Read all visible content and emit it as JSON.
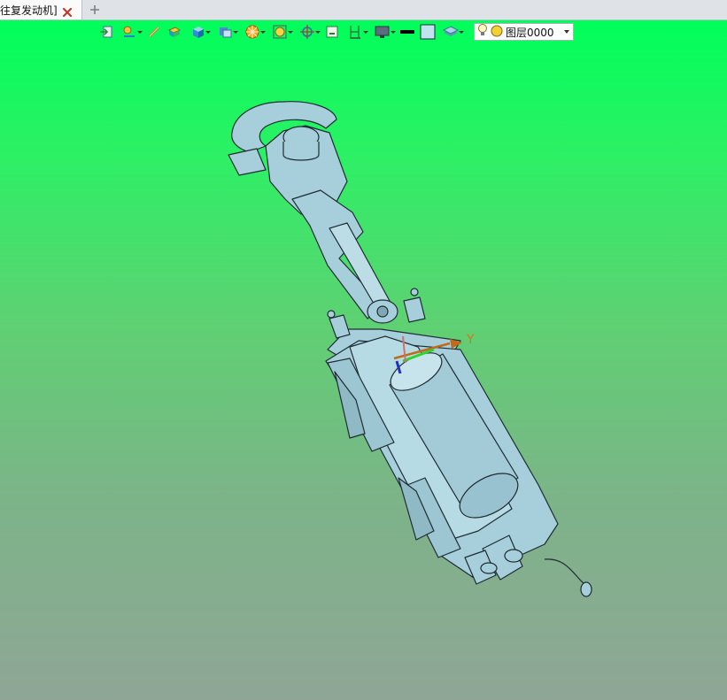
{
  "tab": {
    "title": "往复发动机]",
    "close_icon": "close-icon",
    "add_icon": "plus-icon"
  },
  "toolbar": {
    "buttons": [
      "import-icon",
      "render-mode-icon",
      "measure-icon",
      "face-select-icon",
      "view-cube-icon",
      "section-icon",
      "explode-icon",
      "zoom-fit-icon",
      "rotate-icon",
      "frame-icon",
      "height-icon",
      "display-icon",
      "line-color-icon",
      "fill-color-icon",
      "layer-stack-icon"
    ],
    "layer_combo": {
      "label": "图层0000",
      "bulb_icon": "lightbulb-icon",
      "color_icon": "layer-color-icon"
    }
  },
  "viewport": {
    "axis_y_label": "Y",
    "background_top": "#00ff5a",
    "background_bottom": "#8fa696",
    "model_color": "#a6cfdb"
  }
}
